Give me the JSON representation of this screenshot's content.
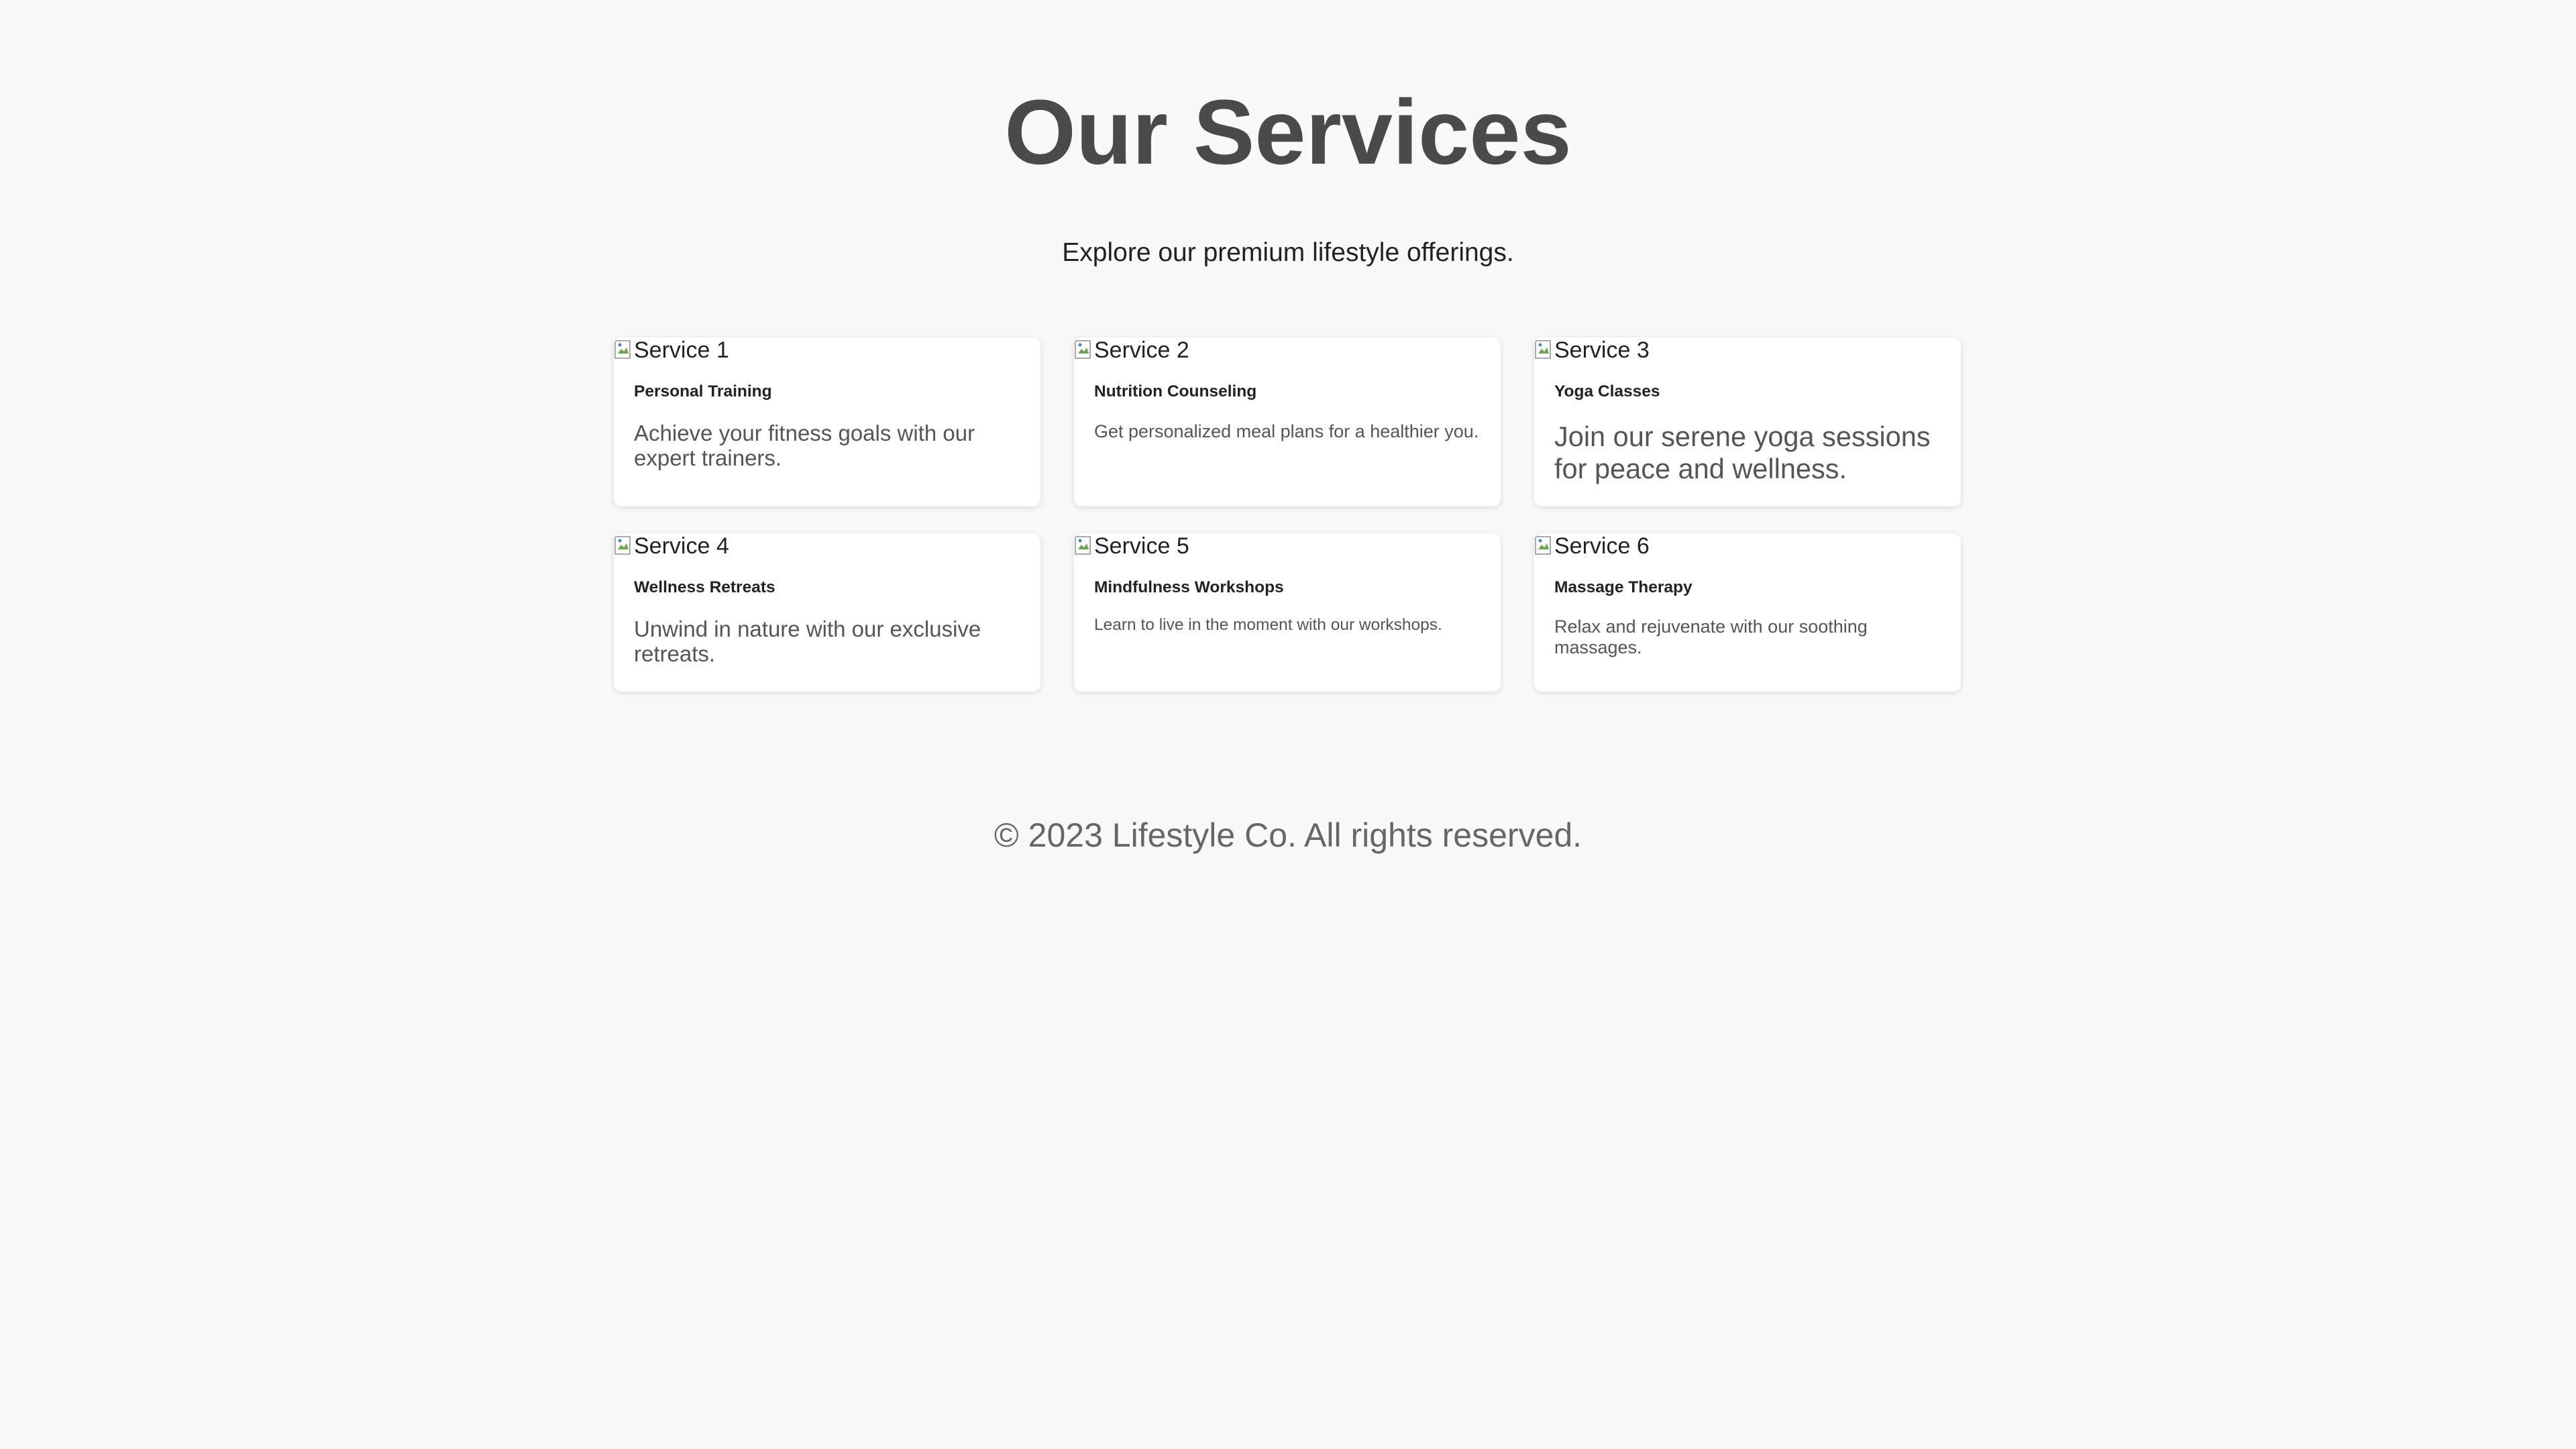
{
  "header": {
    "title": "Our Services",
    "subtitle": "Explore our premium lifestyle offerings."
  },
  "services": [
    {
      "image_alt": "Service 1",
      "title": "Personal Training",
      "description": "Achieve your fitness goals with our expert trainers."
    },
    {
      "image_alt": "Service 2",
      "title": "Nutrition Counseling",
      "description": "Get personalized meal plans for a healthier you."
    },
    {
      "image_alt": "Service 3",
      "title": "Yoga Classes",
      "description": "Join our serene yoga sessions for peace and wellness."
    },
    {
      "image_alt": "Service 4",
      "title": "Wellness Retreats",
      "description": "Unwind in nature with our exclusive retreats."
    },
    {
      "image_alt": "Service 5",
      "title": "Mindfulness Workshops",
      "description": "Learn to live in the moment with our workshops."
    },
    {
      "image_alt": "Service 6",
      "title": "Massage Therapy",
      "description": "Relax and rejuvenate with our soothing massages."
    }
  ],
  "footer": {
    "copyright": "© 2023 Lifestyle Co. All rights reserved."
  }
}
